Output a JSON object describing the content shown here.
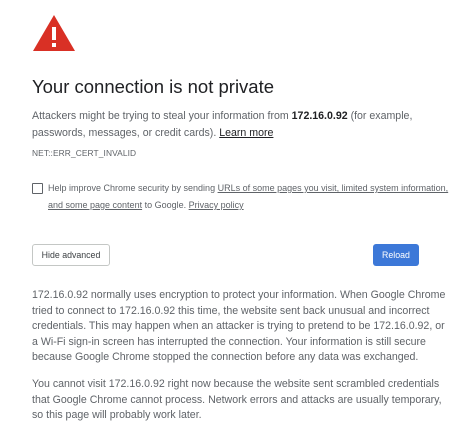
{
  "interstitial": {
    "title": "Your connection is not private",
    "intro_before": "Attackers might be trying to steal your information from ",
    "host": "172.16.0.92",
    "intro_after": " (for example, passwords, messages, or credit cards). ",
    "learn_more": "Learn more",
    "error_code": "NET::ERR_CERT_INVALID",
    "checkbox": {
      "checked": false,
      "text_before": "Help improve Chrome security by sending ",
      "link_urls": "URLs of some pages you visit, limited system information, and some page content",
      "text_middle": " to Google. ",
      "link_privacy": "Privacy policy"
    },
    "buttons": {
      "hide_advanced": "Hide advanced",
      "reload": "Reload"
    },
    "details_1": "172.16.0.92 normally uses encryption to protect your information. When Google Chrome tried to connect to 172.16.0.92 this time, the website sent back unusual and incorrect credentials. This may happen when an attacker is trying to pretend to be 172.16.0.92, or a Wi-Fi sign-in screen has interrupted the connection. Your information is still secure because Google Chrome stopped the connection before any data was exchanged.",
    "details_2": "You cannot visit 172.16.0.92 right now because the website sent scrambled credentials that Google Chrome cannot process. Network errors and attacks are usually temporary, so this page will probably work later."
  },
  "colors": {
    "warning_red": "#d93025",
    "button_blue": "#3c78d8",
    "body_text": "#5f6368",
    "heading_text": "#202124"
  },
  "icons": {
    "warning": "warning-triangle-icon"
  }
}
